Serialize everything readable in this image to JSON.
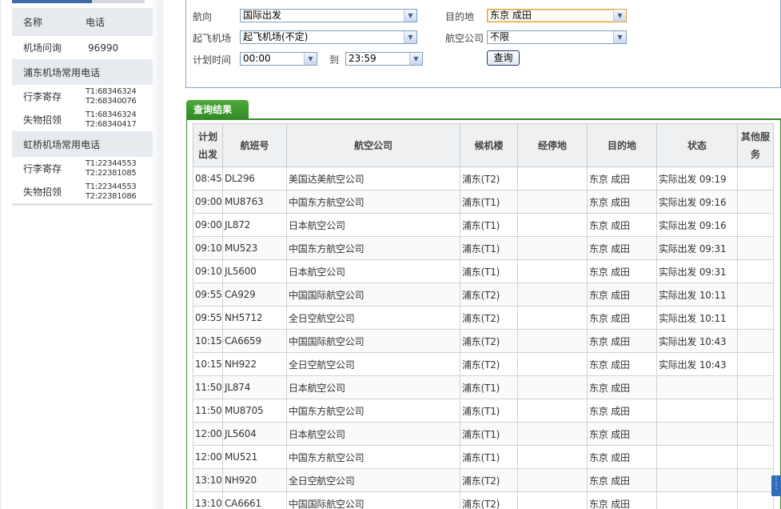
{
  "sidebar": {
    "header": {
      "name": "名称",
      "phone": "电话"
    },
    "enquiry": {
      "label": "机场问询",
      "phone": "96990"
    },
    "pudong": {
      "title": "浦东机场常用电话",
      "items": [
        {
          "label": "行李寄存",
          "phone1": "T1:68346324",
          "phone2": "T2:68340076"
        },
        {
          "label": "失物招领",
          "phone1": "T1:68346324",
          "phone2": "T2:68340417"
        }
      ]
    },
    "hongqiao": {
      "title": "虹桥机场常用电话",
      "items": [
        {
          "label": "行李寄存",
          "phone1": "T1:22344553",
          "phone2": "T2:22381085"
        },
        {
          "label": "失物招领",
          "phone1": "T1:22344553",
          "phone2": "T2:22381086"
        }
      ]
    }
  },
  "search": {
    "direction_label": "航向",
    "direction_value": "国际出发",
    "destination_label": "目的地",
    "destination_value": "东京 成田",
    "airport_label": "起飞机场",
    "airport_value": "起飞机场(不定)",
    "airline_label": "航空公司",
    "airline_value": "不限",
    "time_label": "计划时间",
    "time_from": "00:00",
    "time_to_label": "到",
    "time_to": "23:59",
    "query_button": "查询"
  },
  "results": {
    "tab_label": "查询结果",
    "headers": {
      "sched_line1": "计划",
      "sched_line2": "出发",
      "flight": "航班号",
      "airline": "航空公司",
      "terminal": "候机楼",
      "via": "经停地",
      "dest": "目的地",
      "status": "状态",
      "other_line1": "其他服",
      "other_line2": "务"
    },
    "rows": [
      {
        "time": "08:45",
        "flight": "DL296",
        "airline": "美国达美航空公司",
        "terminal": "浦东(T2)",
        "via": "",
        "dest": "东京 成田",
        "status": "实际出发 09:19",
        "other": ""
      },
      {
        "time": "09:00",
        "flight": "MU8763",
        "airline": "中国东方航空公司",
        "terminal": "浦东(T1)",
        "via": "",
        "dest": "东京 成田",
        "status": "实际出发 09:16",
        "other": ""
      },
      {
        "time": "09:00",
        "flight": "JL872",
        "airline": "日本航空公司",
        "terminal": "浦东(T1)",
        "via": "",
        "dest": "东京 成田",
        "status": "实际出发 09:16",
        "other": ""
      },
      {
        "time": "09:10",
        "flight": "MU523",
        "airline": "中国东方航空公司",
        "terminal": "浦东(T1)",
        "via": "",
        "dest": "东京 成田",
        "status": "实际出发 09:31",
        "other": ""
      },
      {
        "time": "09:10",
        "flight": "JL5600",
        "airline": "日本航空公司",
        "terminal": "浦东(T1)",
        "via": "",
        "dest": "东京 成田",
        "status": "实际出发 09:31",
        "other": ""
      },
      {
        "time": "09:55",
        "flight": "CA929",
        "airline": "中国国际航空公司",
        "terminal": "浦东(T2)",
        "via": "",
        "dest": "东京 成田",
        "status": "实际出发 10:11",
        "other": ""
      },
      {
        "time": "09:55",
        "flight": "NH5712",
        "airline": "全日空航空公司",
        "terminal": "浦东(T2)",
        "via": "",
        "dest": "东京 成田",
        "status": "实际出发 10:11",
        "other": ""
      },
      {
        "time": "10:15",
        "flight": "CA6659",
        "airline": "中国国际航空公司",
        "terminal": "浦东(T2)",
        "via": "",
        "dest": "东京 成田",
        "status": "实际出发 10:43",
        "other": ""
      },
      {
        "time": "10:15",
        "flight": "NH922",
        "airline": "全日空航空公司",
        "terminal": "浦东(T2)",
        "via": "",
        "dest": "东京 成田",
        "status": "实际出发 10:43",
        "other": ""
      },
      {
        "time": "11:50",
        "flight": "JL874",
        "airline": "日本航空公司",
        "terminal": "浦东(T1)",
        "via": "",
        "dest": "东京 成田",
        "status": "",
        "other": ""
      },
      {
        "time": "11:50",
        "flight": "MU8705",
        "airline": "中国东方航空公司",
        "terminal": "浦东(T1)",
        "via": "",
        "dest": "东京 成田",
        "status": "",
        "other": ""
      },
      {
        "time": "12:00",
        "flight": "JL5604",
        "airline": "日本航空公司",
        "terminal": "浦东(T1)",
        "via": "",
        "dest": "东京 成田",
        "status": "",
        "other": ""
      },
      {
        "time": "12:00",
        "flight": "MU521",
        "airline": "中国东方航空公司",
        "terminal": "浦东(T1)",
        "via": "",
        "dest": "东京 成田",
        "status": "",
        "other": ""
      },
      {
        "time": "13:10",
        "flight": "NH920",
        "airline": "全日空航空公司",
        "terminal": "浦东(T2)",
        "via": "",
        "dest": "东京 成田",
        "status": "",
        "other": ""
      },
      {
        "time": "13:10",
        "flight": "CA6661",
        "airline": "中国国际航空公司",
        "terminal": "浦东(T2)",
        "via": "",
        "dest": "东京 成田",
        "status": "",
        "other": ""
      }
    ]
  },
  "icons": {
    "dropdown_arrow": "chevron-down-icon",
    "scroll_handle": "scroll-handle-icon"
  },
  "colors": {
    "accent_green": "#2f8a23",
    "accent_blue": "#3b6ca8",
    "focus_orange": "#e8a33a"
  }
}
